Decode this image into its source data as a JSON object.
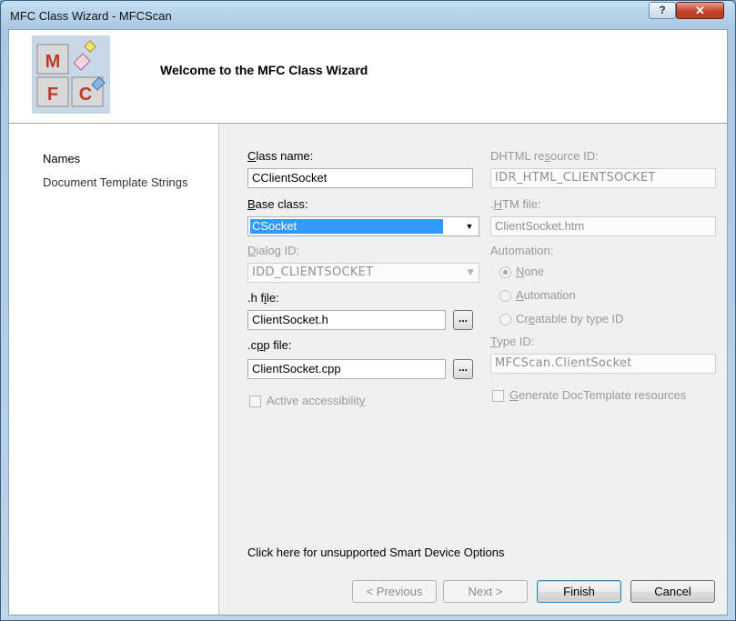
{
  "window": {
    "title": "MFC Class Wizard - MFCScan",
    "help_label": "?",
    "close_label": "✕"
  },
  "header": {
    "title": "Welcome to the MFC Class Wizard",
    "logo": {
      "letters": [
        "M",
        "F",
        "C"
      ],
      "icon": "mfc-wizard-logo"
    }
  },
  "sidebar": {
    "items": [
      {
        "label": "Names",
        "selected": true
      },
      {
        "label": "Document Template Strings",
        "selected": false
      }
    ]
  },
  "form": {
    "class_name": {
      "label_u": "C",
      "label_rest": "lass name:",
      "value": "CClientSocket"
    },
    "base_class": {
      "label_u": "B",
      "label_rest": "ase class:",
      "value": "CSocket"
    },
    "dialog_id": {
      "label_u": "D",
      "label_rest": "ialog ID:",
      "value": "IDD_CLIENTSOCKET"
    },
    "h_file": {
      "label_a": ".h f",
      "label_u": "i",
      "label_b": "le:",
      "value": "ClientSocket.h",
      "browse": "..."
    },
    "cpp_file": {
      "label_a": ".c",
      "label_u": "p",
      "label_b": "p file:",
      "value": "ClientSocket.cpp",
      "browse": "..."
    },
    "accessibility": {
      "label_a": "Active accessibilit",
      "label_u": "y",
      "checked": false
    },
    "dhtml_id": {
      "label_a": "DHTML re",
      "label_u": "s",
      "label_b": "ource ID:",
      "value": "IDR_HTML_CLIENTSOCKET"
    },
    "htm_file": {
      "label_a": ".",
      "label_u": "H",
      "label_b": "TM file:",
      "value": "ClientSocket.htm"
    },
    "automation": {
      "label": "Automation:",
      "options": [
        {
          "u": "N",
          "rest": "one",
          "checked": true
        },
        {
          "u": "A",
          "rest": "utomation",
          "checked": false
        },
        {
          "pre": "Cr",
          "u": "e",
          "rest": "atable by type ID",
          "checked": false
        }
      ]
    },
    "type_id": {
      "label_u": "T",
      "label_rest": "ype ID:",
      "value": "MFCScan.ClientSocket"
    },
    "doctemplate": {
      "label_u": "G",
      "label_rest": "enerate DocTemplate resources",
      "checked": false
    }
  },
  "smart_device_link": "Click here for unsupported Smart Device Options",
  "buttons": {
    "previous": "< Previous",
    "next": "Next >",
    "finish": "Finish",
    "cancel": "Cancel"
  },
  "colors": {
    "selection": "#3399ff",
    "header_bg": "#ffffff",
    "dialog_bg": "#f0f0f0"
  }
}
